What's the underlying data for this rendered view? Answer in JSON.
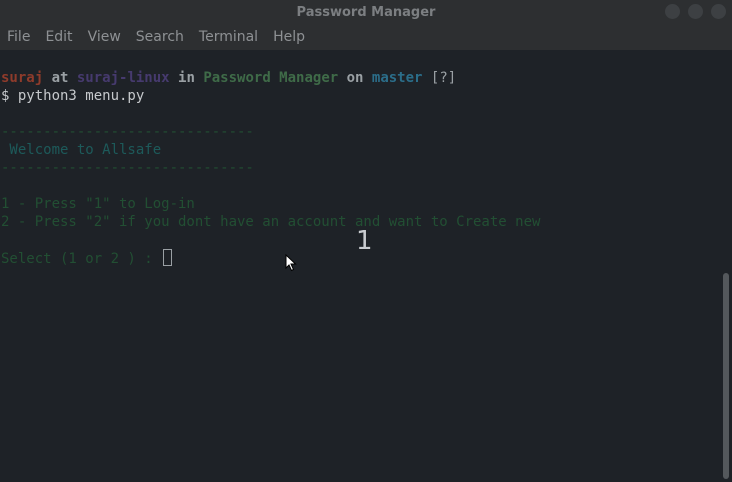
{
  "window": {
    "title": "Password Manager"
  },
  "menu": [
    "File",
    "Edit",
    "View",
    "Search",
    "Terminal",
    "Help"
  ],
  "terminal": {
    "prompt": {
      "user": "suraj",
      "at": " at ",
      "host": "suraj-linux",
      "in": " in ",
      "dir": "Password Manager",
      "on": " on ",
      "branch": "master",
      "status": " [?]"
    },
    "command": "$ python3 menu.py",
    "separator1": "------------------------------",
    "welcome": " Welcome to Allsafe",
    "separator2": "------------------------------",
    "option1": "1 - Press \"1\" to Log-in",
    "option2": "2 - Press \"2\" if you dont have an account and want to Create new",
    "select": "Select (1 or 2 ) : "
  },
  "overlay": {
    "keypress": "1"
  },
  "colors": {
    "background": "#1e2227",
    "titlebar": "#2d2f31",
    "user": "#8f3b2b",
    "host": "#463a6e",
    "dir": "#3f6b48",
    "branch": "#2b6d89",
    "menu_text_green": "#224f33",
    "welcome_teal": "#1d5a5a"
  },
  "icons": {
    "window_buttons": [
      "minimize-icon",
      "maximize-icon",
      "close-icon"
    ],
    "pointer": "mouse-pointer-icon"
  }
}
